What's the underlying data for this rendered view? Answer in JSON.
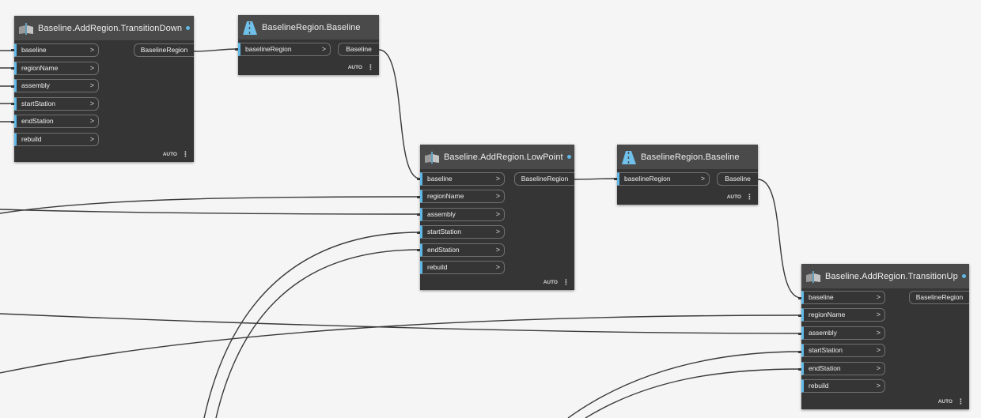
{
  "colors": {
    "background": "#f5f5f5",
    "node_body": "#353535",
    "node_header": "#4a4a4a",
    "port_accent": "#5fb8e6",
    "wire": "#3a3a3a"
  },
  "nodes": {
    "transition_down": {
      "title": "Baseline.AddRegion.TransitionDown",
      "icon": "add-region-icon",
      "inputs": [
        "baseline",
        "regionName",
        "assembly",
        "startStation",
        "endStation",
        "rebuild"
      ],
      "output": "BaselineRegion",
      "lacing": "AUTO"
    },
    "region_baseline_1": {
      "title": "BaselineRegion.Baseline",
      "icon": "road-icon",
      "inputs": [
        "baselineRegion"
      ],
      "output": "Baseline",
      "lacing": "AUTO"
    },
    "low_point": {
      "title": "Baseline.AddRegion.LowPoint",
      "icon": "add-region-icon",
      "inputs": [
        "baseline",
        "regionName",
        "assembly",
        "startStation",
        "endStation",
        "rebuild"
      ],
      "output": "BaselineRegion",
      "lacing": "AUTO"
    },
    "region_baseline_2": {
      "title": "BaselineRegion.Baseline",
      "icon": "road-icon",
      "inputs": [
        "baselineRegion"
      ],
      "output": "Baseline",
      "lacing": "AUTO"
    },
    "transition_up": {
      "title": "Baseline.AddRegion.TransitionUp",
      "icon": "add-region-icon",
      "inputs": [
        "baseline",
        "regionName",
        "assembly",
        "startStation",
        "endStation",
        "rebuild"
      ],
      "output": "BaselineRegion",
      "lacing": "AUTO"
    }
  }
}
